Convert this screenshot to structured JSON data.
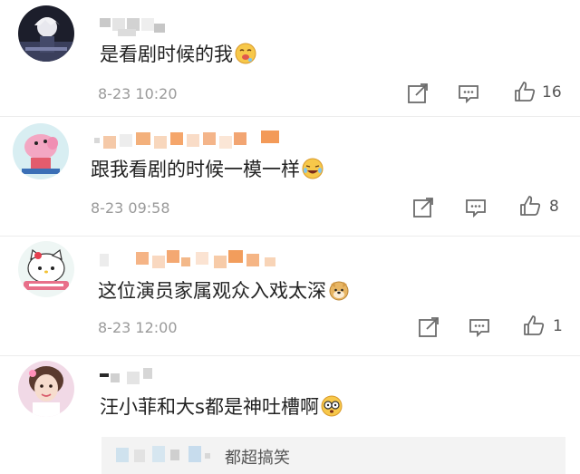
{
  "comments": [
    {
      "text": "是看剧时候的我",
      "emoji": "drooling-face-emoji",
      "time": "8-23 10:20",
      "likes": "16",
      "avatar": "anime-character-avatar"
    },
    {
      "text": "跟我看剧的时候一模一样",
      "emoji": "laughing-crying-emoji",
      "time": "8-23 09:58",
      "likes": "8",
      "avatar": "peppa-pig-avatar"
    },
    {
      "text": "这位演员家属观众入戏太深",
      "emoji": "doge-emoji",
      "time": "8-23 12:00",
      "likes": "1",
      "avatar": "hello-kitty-avatar"
    },
    {
      "text": "汪小菲和大s都是神吐槽啊",
      "emoji": "surprised-glasses-emoji",
      "avatar": "girl-photo-avatar"
    }
  ],
  "reply": {
    "text": "都超搞笑"
  },
  "colors": {
    "time": "#9a9a9a",
    "icon": "#6b6b6b",
    "reply_bg": "#f3f3f3",
    "blur_orange": "#f5a66b"
  }
}
